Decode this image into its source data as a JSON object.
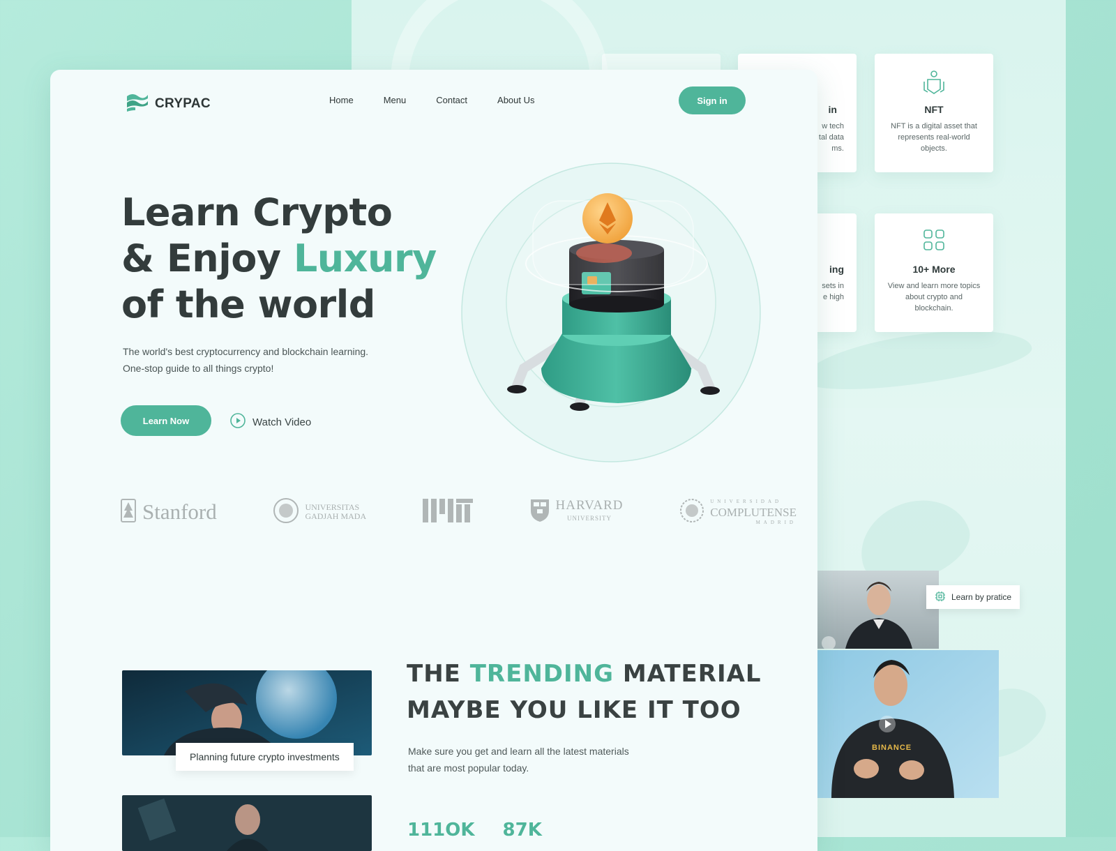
{
  "brand": {
    "name": "CRYPAC"
  },
  "nav": {
    "home": "Home",
    "menu": "Menu",
    "contact": "Contact",
    "about": "About Us"
  },
  "signin_label": "Sign in",
  "hero": {
    "title_line1": "Learn Crypto",
    "title_line2_a": "& Enjoy ",
    "title_line2_b": "Luxury",
    "title_line3": "of the world",
    "subtitle_line1": "The world's best cryptocurrency and blockchain learning.",
    "subtitle_line2": "One-stop guide to all things crypto!",
    "learn_label": "Learn Now",
    "watch_label": "Watch Video"
  },
  "features": [
    {
      "title": "in",
      "desc": "w tech\ntal data\nms."
    },
    {
      "title": "NFT",
      "desc": "NFT is a digital asset that represents real-world objects."
    },
    {
      "title": "ing",
      "desc": "sets in\ne high"
    },
    {
      "title": "10+ More",
      "desc": "View and learn more topics about crypto and blockchain."
    }
  ],
  "partners": {
    "stanford": "Stanford",
    "gadjah_1": "UNIVERSITAS",
    "gadjah_2": "GADJAH MADA",
    "mit": "MIT",
    "harvard": "HARVARD",
    "harvard_sub": "UNIVERSITY",
    "compl_top": "UNIVERSIDAD",
    "compl": "COMPLUTENSE",
    "compl_bottom": "MADRID"
  },
  "trending": {
    "title_a": "THE ",
    "title_b": "TRENDING",
    "title_c": " MATERIAL",
    "title_line2": "MAYBE YOU LIKE IT TOO",
    "subtitle_line1": "Make sure you get and learn all the latest materials",
    "subtitle_line2": "that are most popular today.",
    "caption": "Planning future crypto investments",
    "stat1": "111OK",
    "stat2": "87K"
  },
  "side": {
    "badge": "Learn by pratice",
    "video_brand": "BINANCE"
  },
  "colors": {
    "accent": "#4fb59a",
    "text": "#333c3c",
    "bg": "#f3fbfb"
  }
}
